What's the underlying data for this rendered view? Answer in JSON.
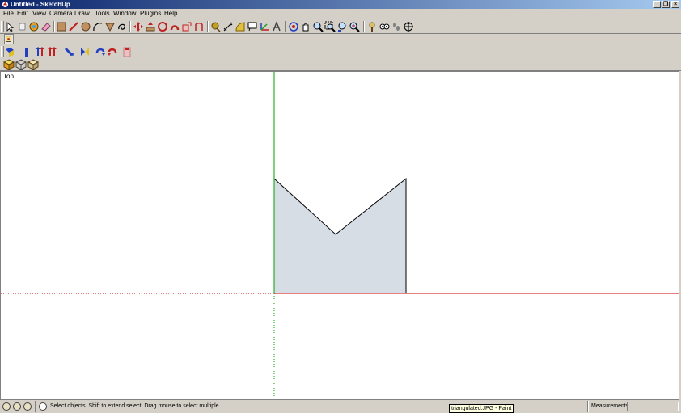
{
  "window": {
    "title": "Untitled - SketchUp",
    "minimize_glyph": "_",
    "maximize_glyph": "❐",
    "close_glyph": "×"
  },
  "menu": {
    "items": [
      "File",
      "Edit",
      "View",
      "Camera",
      "Draw",
      "Tools",
      "Window",
      "Plugins",
      "Help"
    ]
  },
  "toolbar_icons": {
    "row1": [
      "select-icon",
      "eraser-icon",
      "paint-bucket-icon",
      "eraser-tool-icon",
      "rectangle-icon",
      "line-icon",
      "circle-icon",
      "arc-icon",
      "polygon-icon",
      "freehand-icon",
      "move-icon",
      "push-pull-icon",
      "rotate-icon",
      "follow-me-icon",
      "scale-icon",
      "offset-icon",
      "tape-measure-icon",
      "dimension-icon",
      "protractor-icon",
      "text-icon",
      "axes-icon",
      "3d-text-icon",
      "orbit-icon",
      "pan-icon",
      "zoom-icon",
      "zoom-window-icon",
      "previous-view-icon",
      "zoom-extents-icon",
      "position-camera-icon",
      "look-around-icon",
      "walk-icon",
      "section-plane-icon"
    ],
    "solo": [
      "component-icon"
    ],
    "row2": [
      "iso-view-icon",
      "front-view-icon",
      "top-view-icon",
      "right-view-icon",
      "back-view-icon",
      "left-view-icon",
      "bottom-view-icon",
      "mirror-icon",
      "undo-view-icon",
      "redo-view-icon",
      "clipboard-icon"
    ],
    "row3": [
      "iso-box-icon",
      "wireframe-box-icon",
      "shaded-box-icon"
    ]
  },
  "viewport": {
    "view_name": "Top",
    "colors": {
      "red_axis": "#cc0000",
      "green_axis": "#00a000",
      "face_fill": "#d6dde4",
      "edge": "#000000"
    }
  },
  "status": {
    "hint": "Select objects. Shift to extend select. Drag mouse to select multiple.",
    "tooltip": "triangulated.JPG - Paint",
    "measurements_label": "Measurements",
    "measurements_value": ""
  }
}
